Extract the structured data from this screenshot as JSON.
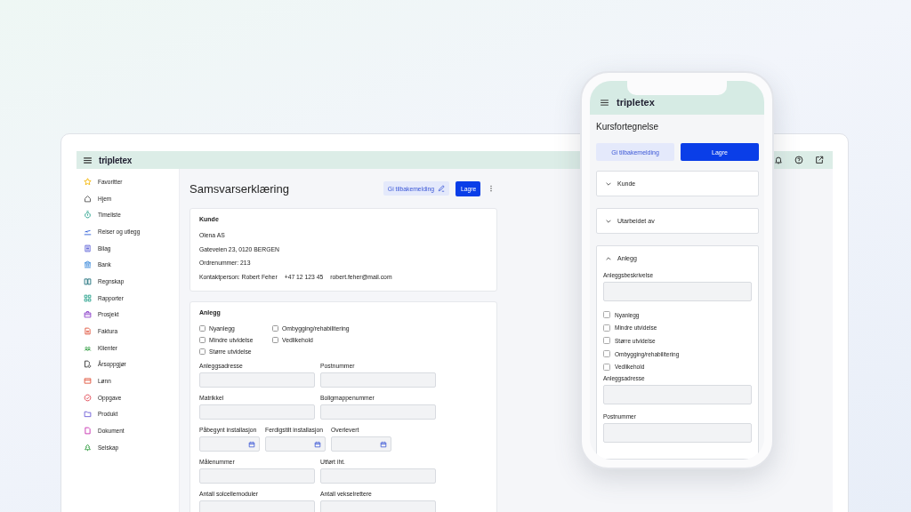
{
  "desktop": {
    "topbar": {
      "logo": "tripletex"
    },
    "sidebar": {
      "items": [
        {
          "label": "Favoritter"
        },
        {
          "label": "Hjem"
        },
        {
          "label": "Timeliste"
        },
        {
          "label": "Reiser og utlegg"
        },
        {
          "label": "Bilag"
        },
        {
          "label": "Bank"
        },
        {
          "label": "Regnskap"
        },
        {
          "label": "Rapporter"
        },
        {
          "label": "Prosjekt"
        },
        {
          "label": "Faktura"
        },
        {
          "label": "Klienter"
        },
        {
          "label": "Årsoppgjør"
        },
        {
          "label": "Lønn"
        },
        {
          "label": "Oppgave"
        },
        {
          "label": "Produkt"
        },
        {
          "label": "Dokument"
        },
        {
          "label": "Selskap"
        }
      ]
    },
    "page": {
      "title": "Samsvarserklæring",
      "feedback_button": "Gi tilbakemelding",
      "save_button": "Lagre"
    },
    "customer_card": {
      "heading": "Kunde",
      "lines": [
        "Olena AS",
        "Gateveien 23, 0120 BERGEN",
        "Ordrenummer: 213"
      ],
      "contact": [
        "Kontaktperson: Robert Feher",
        "+47 12 123 45",
        "robert.feher@mail.com"
      ]
    },
    "installation_card": {
      "heading": "Anlegg",
      "checkboxes": [
        {
          "label": "Nyanlegg",
          "checked": false
        },
        {
          "label": "Mindre utvidelse",
          "checked": false
        },
        {
          "label": "Større utvidelse",
          "checked": false
        },
        {
          "label": "Ombygging/rehabilitering",
          "checked": false
        },
        {
          "label": "Vedlikehold",
          "checked": false
        }
      ],
      "fields": [
        {
          "label": "Anleggsadresse",
          "kind": "text"
        },
        {
          "label": "Postnummer",
          "kind": "text"
        },
        {
          "label": "Matrikkel",
          "kind": "text"
        },
        {
          "label": "Boligmappenummer",
          "kind": "text"
        },
        {
          "label": "Påbegynt installasjon",
          "kind": "date"
        },
        {
          "label": "Ferdigstilt installasjon",
          "kind": "date"
        },
        {
          "label": "Overlevert",
          "kind": "date"
        },
        {
          "label": "Målenummer",
          "kind": "text"
        },
        {
          "label": "Utført iht.",
          "kind": "text"
        },
        {
          "label": "Antall solcellemoduler",
          "kind": "text"
        },
        {
          "label": "Antall vekselrettere",
          "kind": "text"
        }
      ]
    }
  },
  "phone": {
    "logo": "tripletex",
    "title": "Kursfortegnelse",
    "feedback_button": "Gi tilbakemelding",
    "save_button": "Lagre",
    "sections": [
      {
        "title": "Kunde",
        "expanded": false
      },
      {
        "title": "Utarbeidet av",
        "expanded": false
      },
      {
        "title": "Anlegg",
        "expanded": true,
        "items": [
          {
            "kind": "field",
            "label": "Anleggsbeskrivelse"
          },
          {
            "kind": "checkbox",
            "label": "Nyanlegg",
            "checked": false
          },
          {
            "kind": "checkbox",
            "label": "Mindre utvidelse",
            "checked": false
          },
          {
            "kind": "checkbox",
            "label": "Større utvidelse",
            "checked": false
          },
          {
            "kind": "checkbox",
            "label": "Ombygging/rehabilitering",
            "checked": false
          },
          {
            "kind": "checkbox",
            "label": "Vedlikehold",
            "checked": false
          },
          {
            "kind": "field",
            "label": "Anleggsadresse"
          },
          {
            "kind": "field",
            "label": "Postnummer"
          }
        ]
      }
    ]
  }
}
